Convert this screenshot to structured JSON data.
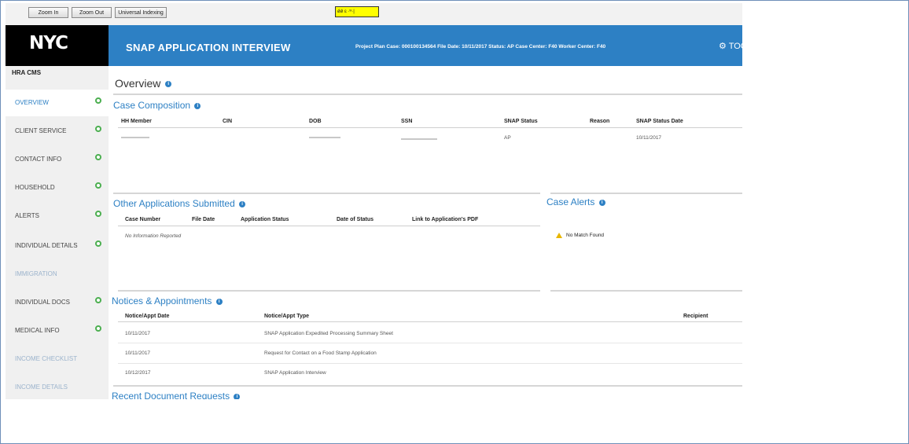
{
  "toolbar": {
    "zoom_in": "Zoom In",
    "zoom_out": "Zoom Out",
    "universal_indexing": "Universal Indexing",
    "zoom_value": "ǿǿ ɛ ·ʷ·|"
  },
  "logo": {
    "text": "NYC"
  },
  "header": {
    "title": "SNAP APPLICATION INTERVIEW",
    "meta": "Project Plan  Case: 000100134564  File Date: 10/11/2017  Status: AP  Case Center: F40  Worker Center: F40",
    "tools": "TOO"
  },
  "sidebar": {
    "brand": "HRA CMS",
    "items": [
      {
        "label": "OVERVIEW"
      },
      {
        "label": "CLIENT SERVICE"
      },
      {
        "label": "CONTACT INFO"
      },
      {
        "label": "HOUSEHOLD"
      },
      {
        "label": "ALERTS"
      },
      {
        "label": "INDIVIDUAL DETAILS"
      },
      {
        "label": "IMMIGRATION"
      },
      {
        "label": "INDIVIDUAL DOCS"
      },
      {
        "label": "MEDICAL INFO"
      },
      {
        "label": "INCOME CHECKLIST"
      },
      {
        "label": "INCOME DETAILS"
      }
    ]
  },
  "overview": {
    "title": "Overview"
  },
  "case_composition": {
    "title": "Case Composition",
    "columns": [
      "HH Member",
      "CIN",
      "DOB",
      "SSN",
      "SNAP Status",
      "Reason",
      "SNAP Status Date"
    ],
    "row": {
      "snap_status": "AP",
      "status_date": "10/11/2017"
    }
  },
  "other_apps": {
    "title": "Other Applications Submitted",
    "columns": [
      "Case Number",
      "File Date",
      "Application Status",
      "Date of Status",
      "Link to Application's PDF"
    ],
    "empty": "No Information Reported"
  },
  "case_alerts": {
    "title": "Case Alerts",
    "message": "No Match Found"
  },
  "notices": {
    "title": "Notices & Appointments",
    "columns": [
      "Notice/Appt Date",
      "Notice/Appt Type",
      "Recipient"
    ],
    "rows": [
      {
        "date": "10/11/2017",
        "type": "SNAP Application Expedited Processing Summary Sheet"
      },
      {
        "date": "10/11/2017",
        "type": "Request for Contact on a Food Stamp Application"
      },
      {
        "date": "10/12/2017",
        "type": "SNAP Application Interview"
      }
    ]
  },
  "recent_docs": {
    "title": "Recent Document Requests"
  }
}
